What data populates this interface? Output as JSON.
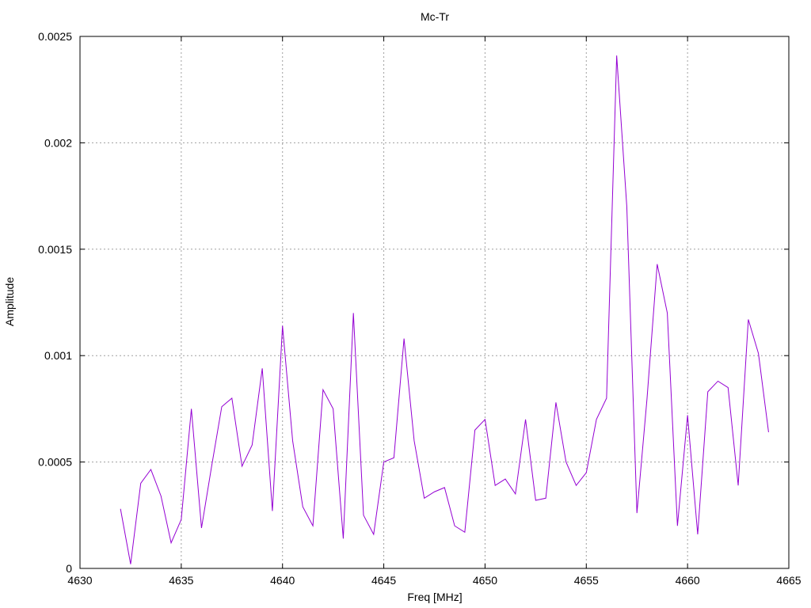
{
  "chart_data": {
    "type": "line",
    "title": "Mc-Tr",
    "xlabel": "Freq [MHz]",
    "ylabel": "Amplitude",
    "xlim": [
      4630,
      4665
    ],
    "ylim": [
      0,
      0.0025
    ],
    "xticks": [
      "4630",
      "4635",
      "4640",
      "4645",
      "4650",
      "4655",
      "4660",
      "4665"
    ],
    "yticks": [
      "0",
      "0.0005",
      "0.001",
      "0.0015",
      "0.002",
      "0.0025"
    ],
    "grid": true,
    "series": [
      {
        "color": "#9400d3",
        "x": [
          4632.0,
          4632.5,
          4633.0,
          4633.5,
          4634.0,
          4634.5,
          4635.0,
          4635.5,
          4636.0,
          4636.5,
          4637.0,
          4637.5,
          4638.0,
          4638.5,
          4639.0,
          4639.5,
          4640.0,
          4640.5,
          4641.0,
          4641.5,
          4642.0,
          4642.5,
          4643.0,
          4643.5,
          4644.0,
          4644.5,
          4645.0,
          4645.5,
          4646.0,
          4646.5,
          4647.0,
          4647.5,
          4648.0,
          4648.5,
          4649.0,
          4649.5,
          4650.0,
          4650.5,
          4651.0,
          4651.5,
          4652.0,
          4652.5,
          4653.0,
          4653.5,
          4654.0,
          4654.5,
          4655.0,
          4655.5,
          4656.0,
          4656.5,
          4657.0,
          4657.5,
          4658.0,
          4658.5,
          4659.0,
          4659.5,
          4660.0,
          4660.5,
          4661.0,
          4661.5,
          4662.0,
          4662.5,
          4663.0,
          4663.5,
          4664.0
        ],
        "y": [
          0.00028,
          2e-05,
          0.0004,
          0.000465,
          0.00034,
          0.00012,
          0.00023,
          0.00075,
          0.00019,
          0.00048,
          0.00076,
          0.0008,
          0.00048,
          0.00058,
          0.00094,
          0.00027,
          0.00114,
          0.0006,
          0.00029,
          0.0002,
          0.00084,
          0.00075,
          0.00014,
          0.0012,
          0.00025,
          0.00016,
          0.0005,
          0.00052,
          0.00108,
          0.0006,
          0.00033,
          0.00036,
          0.00038,
          0.0002,
          0.00017,
          0.00065,
          0.0007,
          0.00039,
          0.00042,
          0.00035,
          0.0007,
          0.00032,
          0.00033,
          0.00078,
          0.0005,
          0.00039,
          0.00045,
          0.0007,
          0.0008,
          0.00241,
          0.0017,
          0.00026,
          0.0008,
          0.00143,
          0.0012,
          0.0002,
          0.00072,
          0.00016,
          0.00083,
          0.00088,
          0.00085,
          0.00039,
          0.00117,
          0.00101,
          0.00064
        ]
      }
    ]
  }
}
